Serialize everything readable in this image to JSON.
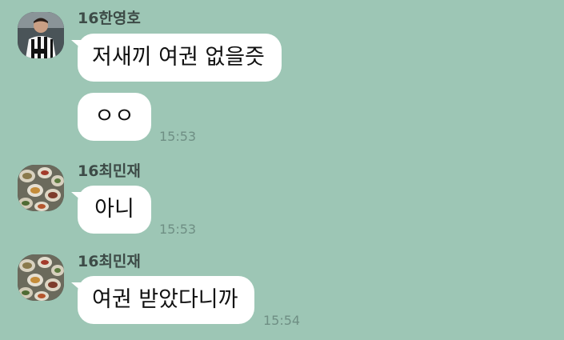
{
  "chat": {
    "messages": [
      {
        "sender": "16한영호",
        "avatar_icon": "soccer-player-avatar",
        "bubbles": [
          "저새끼 여권 없을즛",
          "ㅇㅇ"
        ],
        "time": "15:53"
      },
      {
        "sender": "16최민재",
        "avatar_icon": "food-table-avatar",
        "bubbles": [
          "아니"
        ],
        "time": "15:53"
      },
      {
        "sender": "16최민재",
        "avatar_icon": "food-table-avatar",
        "bubbles": [
          "여권 받았다니까"
        ],
        "time": "15:54"
      }
    ]
  },
  "colors": {
    "background": "#9dc6b5",
    "bubble": "#ffffff",
    "sender_text": "#3d4b47",
    "time_text": "#6f8f84"
  }
}
